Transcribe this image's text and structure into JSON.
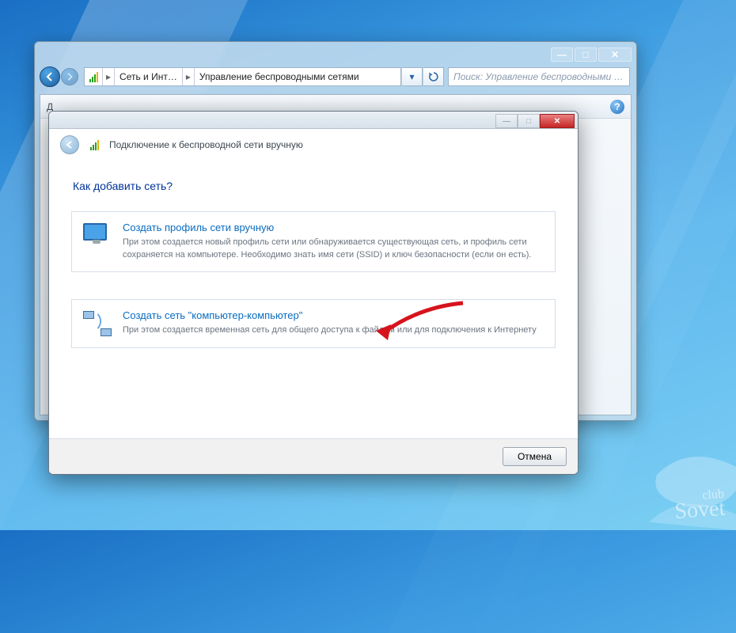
{
  "explorer": {
    "breadcrumb1": "Сеть и Инт…",
    "breadcrumb2": "Управление беспроводными сетями",
    "search_placeholder": "Поиск: Управление беспроводными …",
    "toolbar_left": "Д"
  },
  "wizard": {
    "header": "Подключение к беспроводной сети вручную",
    "title": "Как добавить сеть?",
    "option1": {
      "title": "Создать профиль сети вручную",
      "desc": "При этом создается новый профиль сети или обнаруживается существующая сеть, и профиль сети сохраняется на компьютере. Необходимо знать имя сети (SSID) и ключ безопасности (если он есть)."
    },
    "option2": {
      "title": "Создать сеть \"компьютер-компьютер\"",
      "desc": "При этом создается временная сеть для общего доступа к файлам или для подключения к Интернету"
    },
    "cancel": "Отмена"
  },
  "watermark": {
    "top": "club",
    "bottom": "Sovet"
  }
}
